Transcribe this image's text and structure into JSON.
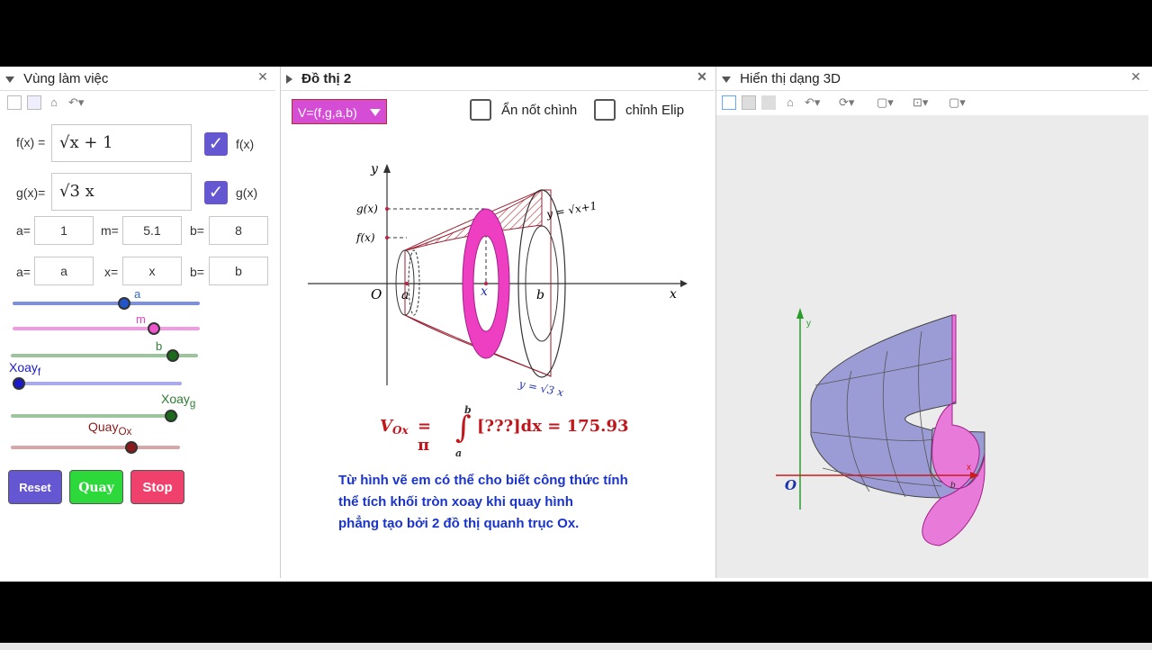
{
  "panels": {
    "left": {
      "title": "Vùng làm việc"
    },
    "middle": {
      "title": "Đồ thị 2"
    },
    "right": {
      "title": "Hiển thị dạng 3D"
    }
  },
  "algebra": {
    "f_label": "f(x) =",
    "f_value": "√x + 1",
    "f_check_label": "f(x)",
    "g_label": "g(x)=",
    "g_value": "√3 x",
    "g_check_label": "g(x)",
    "row1": [
      {
        "label": "a=",
        "value": "1"
      },
      {
        "label": "m=",
        "value": "5.1"
      },
      {
        "label": "b=",
        "value": "8"
      }
    ],
    "row2": [
      {
        "label": "a=",
        "value": "a"
      },
      {
        "label": "x=",
        "value": "x"
      },
      {
        "label": "b=",
        "value": "b"
      }
    ]
  },
  "sliders": [
    {
      "name": "a",
      "color": "#3366cc",
      "value": 0.6
    },
    {
      "name": "m",
      "color": "#dd44cc",
      "value": 0.74
    },
    {
      "name": "b",
      "color": "#2e7d32",
      "value": 1.0
    },
    {
      "name": "Xoay_f",
      "color": "#1a1acc",
      "value": 0.0
    },
    {
      "name": "Xoay_g",
      "color": "#2e7d32",
      "value": 1.0
    },
    {
      "name": "Quay_Ox",
      "color": "#8b1a1a",
      "value": 0.72
    }
  ],
  "slider_labels": {
    "a": "a",
    "m": "m",
    "b": "b",
    "xoayf_main": "Xoay",
    "xoayf_sub": "f",
    "xoayg_main": "Xoay",
    "xoayg_sub": "g",
    "quay_main": "Quay",
    "quay_sub": "Ox"
  },
  "buttons": {
    "reset": "Reset",
    "quay": "Quay",
    "stop": "Stop"
  },
  "graph2": {
    "dropdown": "V=(f,g,a,b)",
    "checkbox1": "Ẩn nốt chình",
    "checkbox2": "chỉnh Elip",
    "axis_y": "y",
    "axis_x": "x",
    "origin": "O",
    "label_gx": "g(x)",
    "label_fx": "f(x)",
    "label_a": "a",
    "label_x": "x",
    "label_b": "b",
    "curve_f": "y = √x+1",
    "curve_g": "y = √3 x",
    "formula_lhs": "V",
    "formula_sub": "Ox",
    "formula_rhs": "= π",
    "integral_upper": "b",
    "integral_lower": "a",
    "formula_body": "[???]dx = 175.93",
    "description": [
      "Từ hình vẽ em có thể cho biết công thức tính",
      "thể tích khối tròn xoay khi quay hình",
      "phẳng tạo bởi 2 đồ thị quanh trục Ox."
    ]
  },
  "view3d": {
    "origin": "O",
    "axis_y": "y",
    "axis_x": "x",
    "label_b": "b"
  },
  "colors": {
    "accent_purple": "#6557d2",
    "pink": "#ee44cc",
    "surface": "#9b9bd6",
    "axis_red": "#cc1a1a",
    "axis_green": "#2a9d2a"
  }
}
